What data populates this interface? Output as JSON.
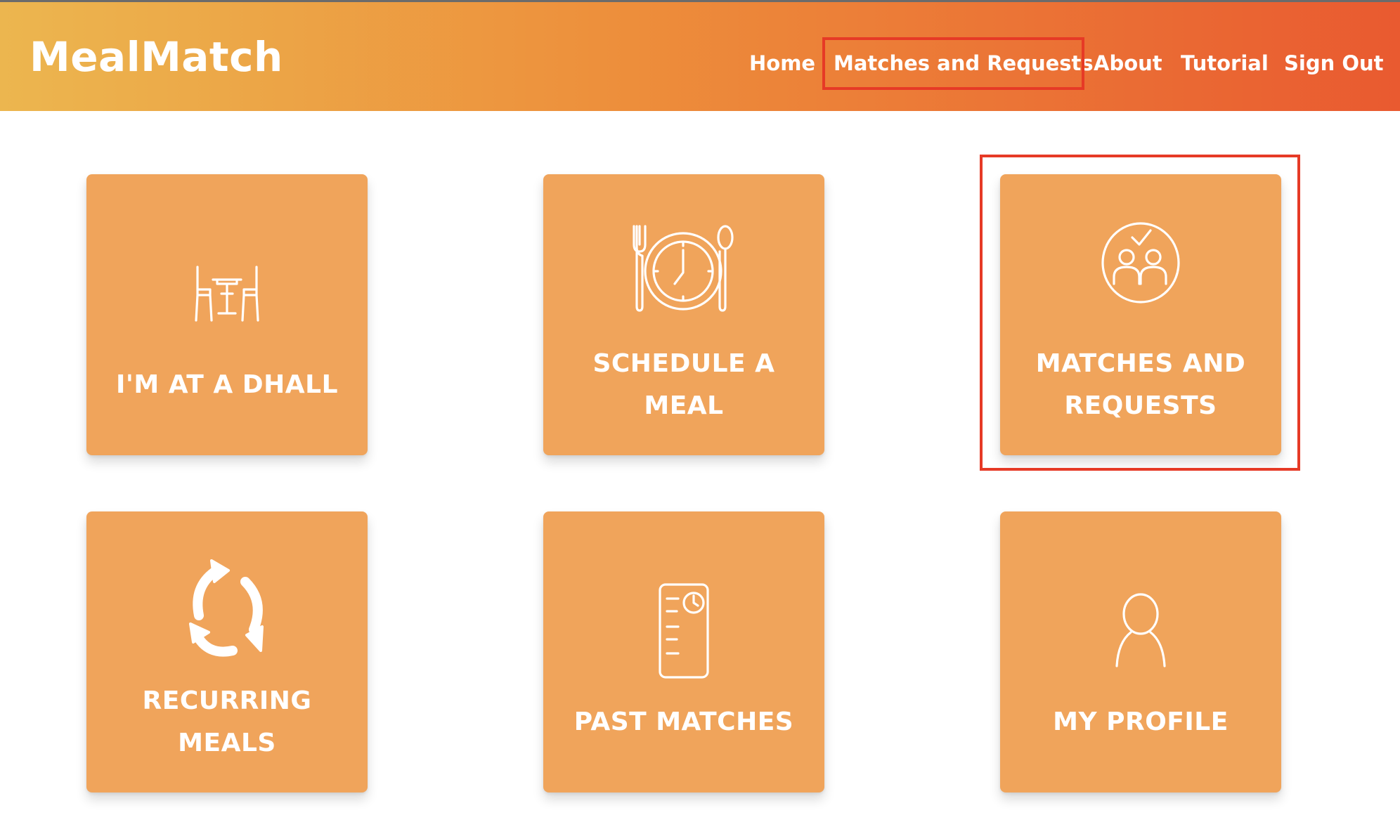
{
  "brand": "MealMatch",
  "nav": {
    "home": "Home",
    "matches": "Matches and Requests",
    "about": "About",
    "tutorial": "Tutorial",
    "signout": "Sign Out"
  },
  "tiles": {
    "dhall": {
      "label": "I'M AT A DHALL",
      "icon": "dining-table-chairs-icon"
    },
    "schedule": {
      "label": "SCHEDULE A\nMEAL",
      "icon": "plate-clock-cutlery-icon"
    },
    "matches": {
      "label": "MATCHES AND\nREQUESTS",
      "icon": "people-check-icon"
    },
    "recurring": {
      "label": "RECURRING\nMEALS",
      "icon": "recycle-arrows-icon"
    },
    "past": {
      "label": "PAST MATCHES",
      "icon": "document-clock-icon"
    },
    "profile": {
      "label": "MY PROFILE",
      "icon": "person-outline-icon"
    }
  },
  "colors": {
    "tile": "#f0a45b",
    "highlight": "#e63a26",
    "nav_gradient_start": "#ecb64f",
    "nav_gradient_end": "#e95a30"
  }
}
